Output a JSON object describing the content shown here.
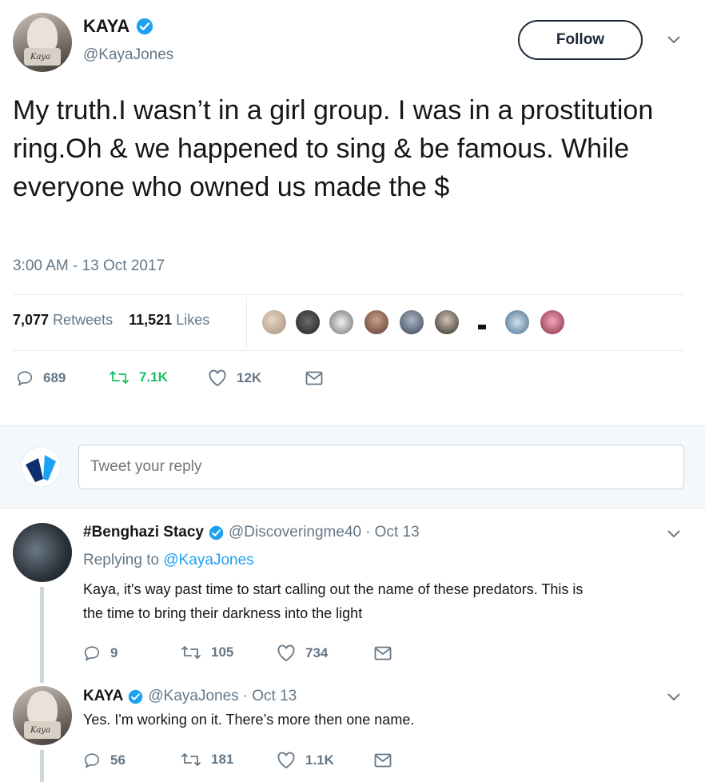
{
  "tweet": {
    "author_name": "KAYA",
    "author_handle": "@KayaJones",
    "avatar_text": "Kaya",
    "follow_label": "Follow",
    "text": "My truth.I wasn’t in a girl group. I was in a prostitution ring.Oh & we happened to sing & be famous. While everyone who owned us made the $",
    "timestamp": "3:00 AM - 13 Oct 2017",
    "retweets_count": "7,077",
    "retweets_label": "Retweets",
    "likes_count": "11,521",
    "likes_label": "Likes",
    "actions": {
      "replies": "689",
      "retweets": "7.1K",
      "likes": "12K"
    }
  },
  "reply_box": {
    "placeholder": "Tweet your reply"
  },
  "replies": [
    {
      "name": "#Benghazi Stacy",
      "handle": "@Discoveringme40",
      "date": "· Oct 13",
      "replying_label": "Replying to",
      "replying_to": "@KayaJones",
      "text_line1": "Kaya, it's way past time to start calling out the name of these predators.  This is",
      "text_line2": "the time to bring their darkness into the light",
      "actions": {
        "replies": "9",
        "retweets": "105",
        "likes": "734"
      }
    },
    {
      "name": "KAYA",
      "handle": "@KayaJones",
      "date": "· Oct 13",
      "text": "Yes. I'm working on it. There’s more then one name.",
      "actions": {
        "replies": "56",
        "retweets": "181",
        "likes": "1.1K"
      }
    }
  ],
  "colors": {
    "accent": "#1da1f2",
    "retweet_green": "#17bf63",
    "thread_line": "#ccd6dd",
    "muted": "#657786"
  }
}
